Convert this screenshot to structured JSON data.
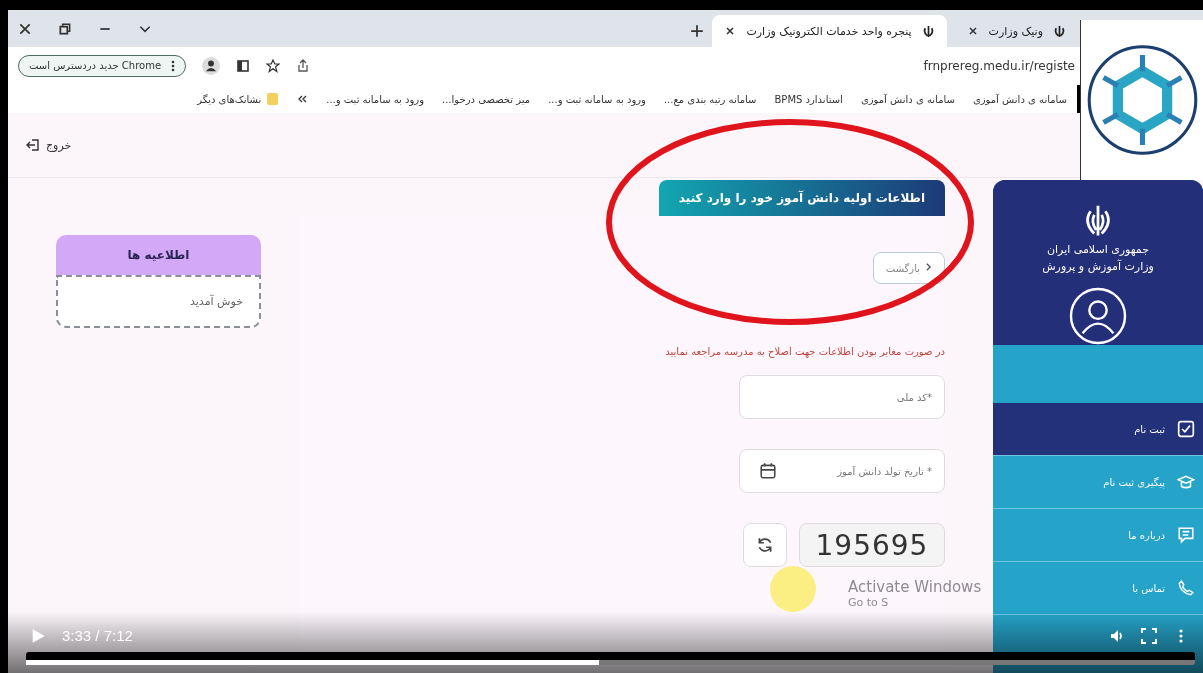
{
  "tabs": [
    {
      "label": "ونیک وزارت",
      "selected": false
    },
    {
      "label": "پنجره واحد خدمات الکترونیک وزارت",
      "selected": true
    }
  ],
  "toolbar": {
    "url": "frnprereg.medu.ir/registe",
    "update_pill": "Chrome جدید دردسترس است"
  },
  "bookmarks": [
    {
      "label": "سامانه ی دانش آموزی"
    },
    {
      "label": "سامانه ی دانش آموزی"
    },
    {
      "label": "استاندارد BPMS"
    },
    {
      "label": "سامانه رتبه بندی مع..."
    },
    {
      "label": "ورود به سامانه ثبت و..."
    },
    {
      "label": "میز تخصصی درخوا..."
    },
    {
      "label": "ورود به سامانه ثبت و..."
    }
  ],
  "other_bookmarks": "نشانک‌های دیگر",
  "header": {
    "logout": "خروج"
  },
  "sidebar": {
    "title_line_1": "جمهوری اسلامی ایران",
    "title_line_2": "وزارت آموزش و پرورش",
    "items": [
      {
        "label": "ثبت نام",
        "selected": true
      },
      {
        "label": "پیگیری ثبت نام",
        "selected": false
      },
      {
        "label": "درباره ما",
        "selected": false
      },
      {
        "label": "تماس با",
        "selected": false
      }
    ]
  },
  "form": {
    "heading": "اطلاعات اولیه دانش آموز خود را وارد کنید",
    "back": "بازگشت",
    "note": "در صورت مغایر بودن اطلاعات جهت اصلاح به مدرسه مراجعه نمایید",
    "national_id": {
      "placeholder": "*کد ملی"
    },
    "birth_date": {
      "placeholder": "* تاریخ تولد دانش آموز"
    },
    "captcha": "195695"
  },
  "notices": {
    "title": "اطلاعیه ها",
    "body": "خوش آمدید"
  },
  "os_watermark": {
    "line_1": "Activate Windows",
    "line_2": "Go to S"
  },
  "video": {
    "time": "3:33 / 7:12",
    "level": 0.49
  }
}
